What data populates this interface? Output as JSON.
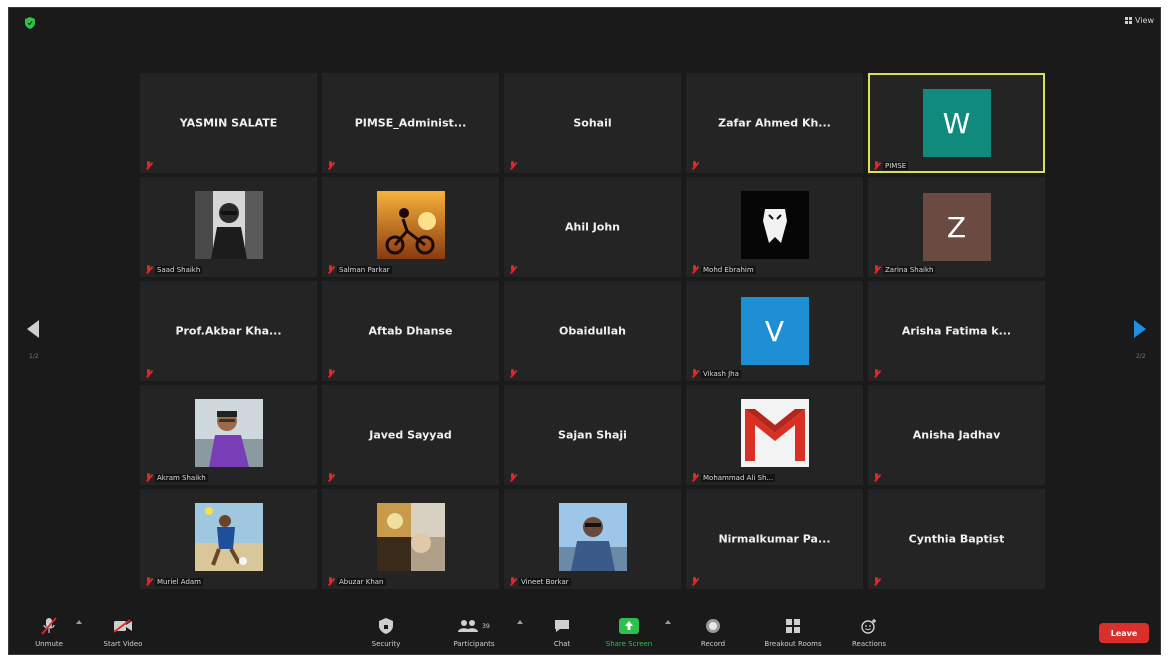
{
  "header": {
    "view_label": "View"
  },
  "pagination": {
    "left": "1/2",
    "right": "2/2"
  },
  "tiles": [
    {
      "name": "YASMIN SALATE",
      "label": ""
    },
    {
      "name": "PIMSE_Administ...",
      "label": ""
    },
    {
      "name": "Sohail",
      "label": ""
    },
    {
      "name": "Zafar Ahmed Kh...",
      "label": ""
    },
    {
      "name": "",
      "label": "PIMSE",
      "avatar": "W",
      "avatar_color": "#0f8a7c",
      "active": true
    },
    {
      "name": "",
      "label": "Saad Shaikh",
      "photo": "man-sunglasses"
    },
    {
      "name": "",
      "label": "Salman Parkar",
      "photo": "cyclist-sunset"
    },
    {
      "name": "Ahil John",
      "label": ""
    },
    {
      "name": "",
      "label": "Mohd Ebrahim",
      "photo": "white-mask"
    },
    {
      "name": "",
      "label": "Zarina Shaikh",
      "avatar": "Z",
      "avatar_color": "#6b4a42"
    },
    {
      "name": "Prof.Akbar  Kha...",
      "label": ""
    },
    {
      "name": "Aftab Dhanse",
      "label": ""
    },
    {
      "name": "Obaidullah",
      "label": ""
    },
    {
      "name": "",
      "label": "Vikash Jha",
      "avatar": "V",
      "avatar_color": "#1e8fd5"
    },
    {
      "name": "Arisha  Fatima  k...",
      "label": ""
    },
    {
      "name": "",
      "label": "Akram Shaikh",
      "photo": "man-purple"
    },
    {
      "name": "Javed Sayyad",
      "label": ""
    },
    {
      "name": "Sajan  Shaji",
      "label": ""
    },
    {
      "name": "",
      "label": "Mohammad Ali Sh...",
      "photo": "gmail-logo"
    },
    {
      "name": "Anisha Jadhav",
      "label": ""
    },
    {
      "name": "",
      "label": "Muriel Adam",
      "photo": "player-beach"
    },
    {
      "name": "",
      "label": "Abuzar Khan",
      "photo": "collage"
    },
    {
      "name": "",
      "label": "Vineet Borkar",
      "photo": "man-denim"
    },
    {
      "name": "Nirmalkumar  Pa...",
      "label": ""
    },
    {
      "name": "Cynthia Baptist",
      "label": ""
    }
  ],
  "toolbar": {
    "unmute": "Unmute",
    "start_video": "Start Video",
    "security": "Security",
    "participants": "Participants",
    "participants_count": "39",
    "chat": "Chat",
    "share_screen": "Share Screen",
    "record": "Record",
    "breakout": "Breakout Rooms",
    "reactions": "Reactions",
    "leave": "Leave"
  },
  "colors": {
    "active_border": "#d9e15a",
    "share_green": "#2fbf4d",
    "leave_red": "#d9302c",
    "nav_blue": "#1e90e0"
  }
}
